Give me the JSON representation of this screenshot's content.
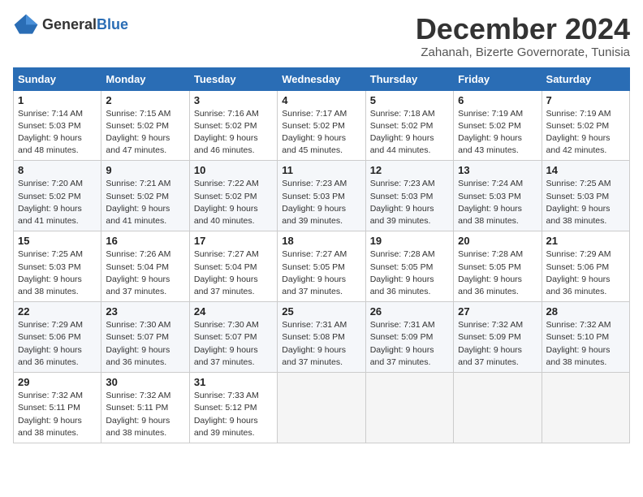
{
  "header": {
    "logo_general": "General",
    "logo_blue": "Blue",
    "month_title": "December 2024",
    "subtitle": "Zahanah, Bizerte Governorate, Tunisia"
  },
  "weekdays": [
    "Sunday",
    "Monday",
    "Tuesday",
    "Wednesday",
    "Thursday",
    "Friday",
    "Saturday"
  ],
  "weeks": [
    [
      {
        "day": "1",
        "sunrise": "7:14 AM",
        "sunset": "5:03 PM",
        "daylight": "9 hours and 48 minutes."
      },
      {
        "day": "2",
        "sunrise": "7:15 AM",
        "sunset": "5:02 PM",
        "daylight": "9 hours and 47 minutes."
      },
      {
        "day": "3",
        "sunrise": "7:16 AM",
        "sunset": "5:02 PM",
        "daylight": "9 hours and 46 minutes."
      },
      {
        "day": "4",
        "sunrise": "7:17 AM",
        "sunset": "5:02 PM",
        "daylight": "9 hours and 45 minutes."
      },
      {
        "day": "5",
        "sunrise": "7:18 AM",
        "sunset": "5:02 PM",
        "daylight": "9 hours and 44 minutes."
      },
      {
        "day": "6",
        "sunrise": "7:19 AM",
        "sunset": "5:02 PM",
        "daylight": "9 hours and 43 minutes."
      },
      {
        "day": "7",
        "sunrise": "7:19 AM",
        "sunset": "5:02 PM",
        "daylight": "9 hours and 42 minutes."
      }
    ],
    [
      {
        "day": "8",
        "sunrise": "7:20 AM",
        "sunset": "5:02 PM",
        "daylight": "9 hours and 41 minutes."
      },
      {
        "day": "9",
        "sunrise": "7:21 AM",
        "sunset": "5:02 PM",
        "daylight": "9 hours and 41 minutes."
      },
      {
        "day": "10",
        "sunrise": "7:22 AM",
        "sunset": "5:02 PM",
        "daylight": "9 hours and 40 minutes."
      },
      {
        "day": "11",
        "sunrise": "7:23 AM",
        "sunset": "5:03 PM",
        "daylight": "9 hours and 39 minutes."
      },
      {
        "day": "12",
        "sunrise": "7:23 AM",
        "sunset": "5:03 PM",
        "daylight": "9 hours and 39 minutes."
      },
      {
        "day": "13",
        "sunrise": "7:24 AM",
        "sunset": "5:03 PM",
        "daylight": "9 hours and 38 minutes."
      },
      {
        "day": "14",
        "sunrise": "7:25 AM",
        "sunset": "5:03 PM",
        "daylight": "9 hours and 38 minutes."
      }
    ],
    [
      {
        "day": "15",
        "sunrise": "7:25 AM",
        "sunset": "5:03 PM",
        "daylight": "9 hours and 38 minutes."
      },
      {
        "day": "16",
        "sunrise": "7:26 AM",
        "sunset": "5:04 PM",
        "daylight": "9 hours and 37 minutes."
      },
      {
        "day": "17",
        "sunrise": "7:27 AM",
        "sunset": "5:04 PM",
        "daylight": "9 hours and 37 minutes."
      },
      {
        "day": "18",
        "sunrise": "7:27 AM",
        "sunset": "5:05 PM",
        "daylight": "9 hours and 37 minutes."
      },
      {
        "day": "19",
        "sunrise": "7:28 AM",
        "sunset": "5:05 PM",
        "daylight": "9 hours and 36 minutes."
      },
      {
        "day": "20",
        "sunrise": "7:28 AM",
        "sunset": "5:05 PM",
        "daylight": "9 hours and 36 minutes."
      },
      {
        "day": "21",
        "sunrise": "7:29 AM",
        "sunset": "5:06 PM",
        "daylight": "9 hours and 36 minutes."
      }
    ],
    [
      {
        "day": "22",
        "sunrise": "7:29 AM",
        "sunset": "5:06 PM",
        "daylight": "9 hours and 36 minutes."
      },
      {
        "day": "23",
        "sunrise": "7:30 AM",
        "sunset": "5:07 PM",
        "daylight": "9 hours and 36 minutes."
      },
      {
        "day": "24",
        "sunrise": "7:30 AM",
        "sunset": "5:07 PM",
        "daylight": "9 hours and 37 minutes."
      },
      {
        "day": "25",
        "sunrise": "7:31 AM",
        "sunset": "5:08 PM",
        "daylight": "9 hours and 37 minutes."
      },
      {
        "day": "26",
        "sunrise": "7:31 AM",
        "sunset": "5:09 PM",
        "daylight": "9 hours and 37 minutes."
      },
      {
        "day": "27",
        "sunrise": "7:32 AM",
        "sunset": "5:09 PM",
        "daylight": "9 hours and 37 minutes."
      },
      {
        "day": "28",
        "sunrise": "7:32 AM",
        "sunset": "5:10 PM",
        "daylight": "9 hours and 38 minutes."
      }
    ],
    [
      {
        "day": "29",
        "sunrise": "7:32 AM",
        "sunset": "5:11 PM",
        "daylight": "9 hours and 38 minutes."
      },
      {
        "day": "30",
        "sunrise": "7:32 AM",
        "sunset": "5:11 PM",
        "daylight": "9 hours and 38 minutes."
      },
      {
        "day": "31",
        "sunrise": "7:33 AM",
        "sunset": "5:12 PM",
        "daylight": "9 hours and 39 minutes."
      },
      null,
      null,
      null,
      null
    ]
  ]
}
